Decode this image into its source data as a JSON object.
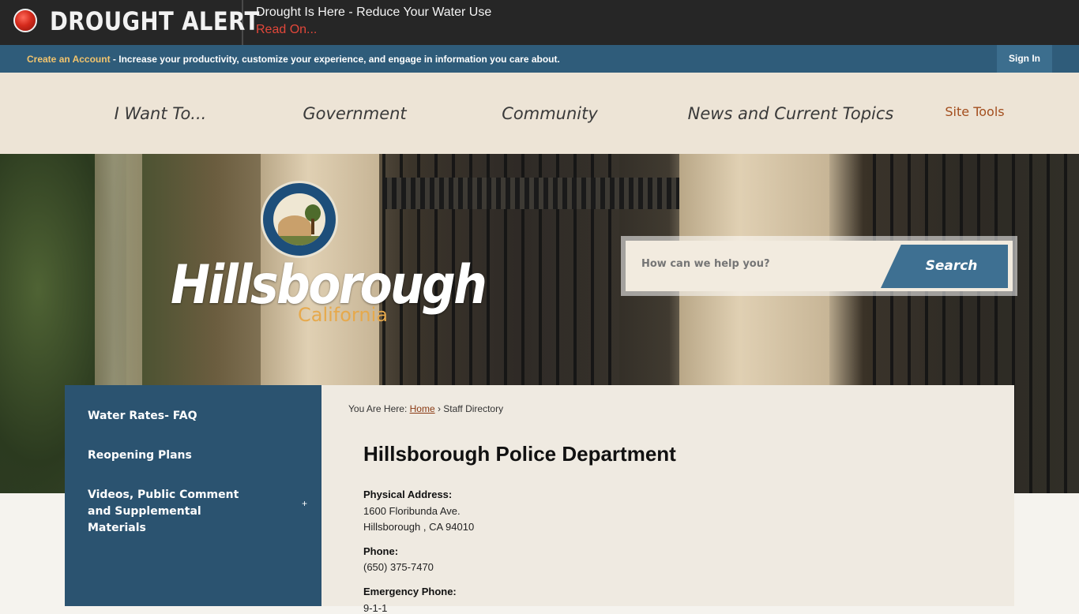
{
  "alert": {
    "title": "DROUGHT ALERT",
    "message": "Drought Is Here - Reduce Your Water Use",
    "link": "Read On..."
  },
  "account_bar": {
    "create_link": "Create an Account",
    "text": " - Increase your productivity, customize your experience, and engage in information you care about.",
    "sign_in": "Sign In"
  },
  "nav": {
    "items": [
      "I Want To...",
      "Government",
      "Community",
      "News and Current Topics"
    ],
    "site_tools": "Site Tools"
  },
  "logo": {
    "name": "Hillsborough",
    "state": "California"
  },
  "search": {
    "placeholder": "How can we help you?",
    "button": "Search"
  },
  "sidebar": {
    "items": [
      {
        "label": "Water Rates- FAQ"
      },
      {
        "label": "Reopening Plans"
      },
      {
        "label": "Videos, Public Comment and Supplemental Materials",
        "expand": "+"
      }
    ]
  },
  "breadcrumb": {
    "prefix": "You Are Here: ",
    "home": "Home",
    "separator": " › ",
    "current": "Staff Directory"
  },
  "department": {
    "title": "Hillsborough Police Department",
    "physical_address_label": "Physical Address:",
    "address_line1": "1600 Floribunda Ave.",
    "address_line2": "Hillsborough , CA 94010",
    "phone_label": "Phone:",
    "phone": "(650) 375-7470",
    "emergency_label": "Emergency Phone:",
    "emergency_phone": "9-1-1"
  },
  "colors": {
    "alert_bg": "#262626",
    "alert_red": "#e2473a",
    "account_bar": "#2f5c7a",
    "nav_bg": "#ede4d6",
    "site_tools": "#a34e1e",
    "sidebar": "#2b5370",
    "search_button": "#3e7092",
    "logo_sub": "#e6a94c"
  }
}
